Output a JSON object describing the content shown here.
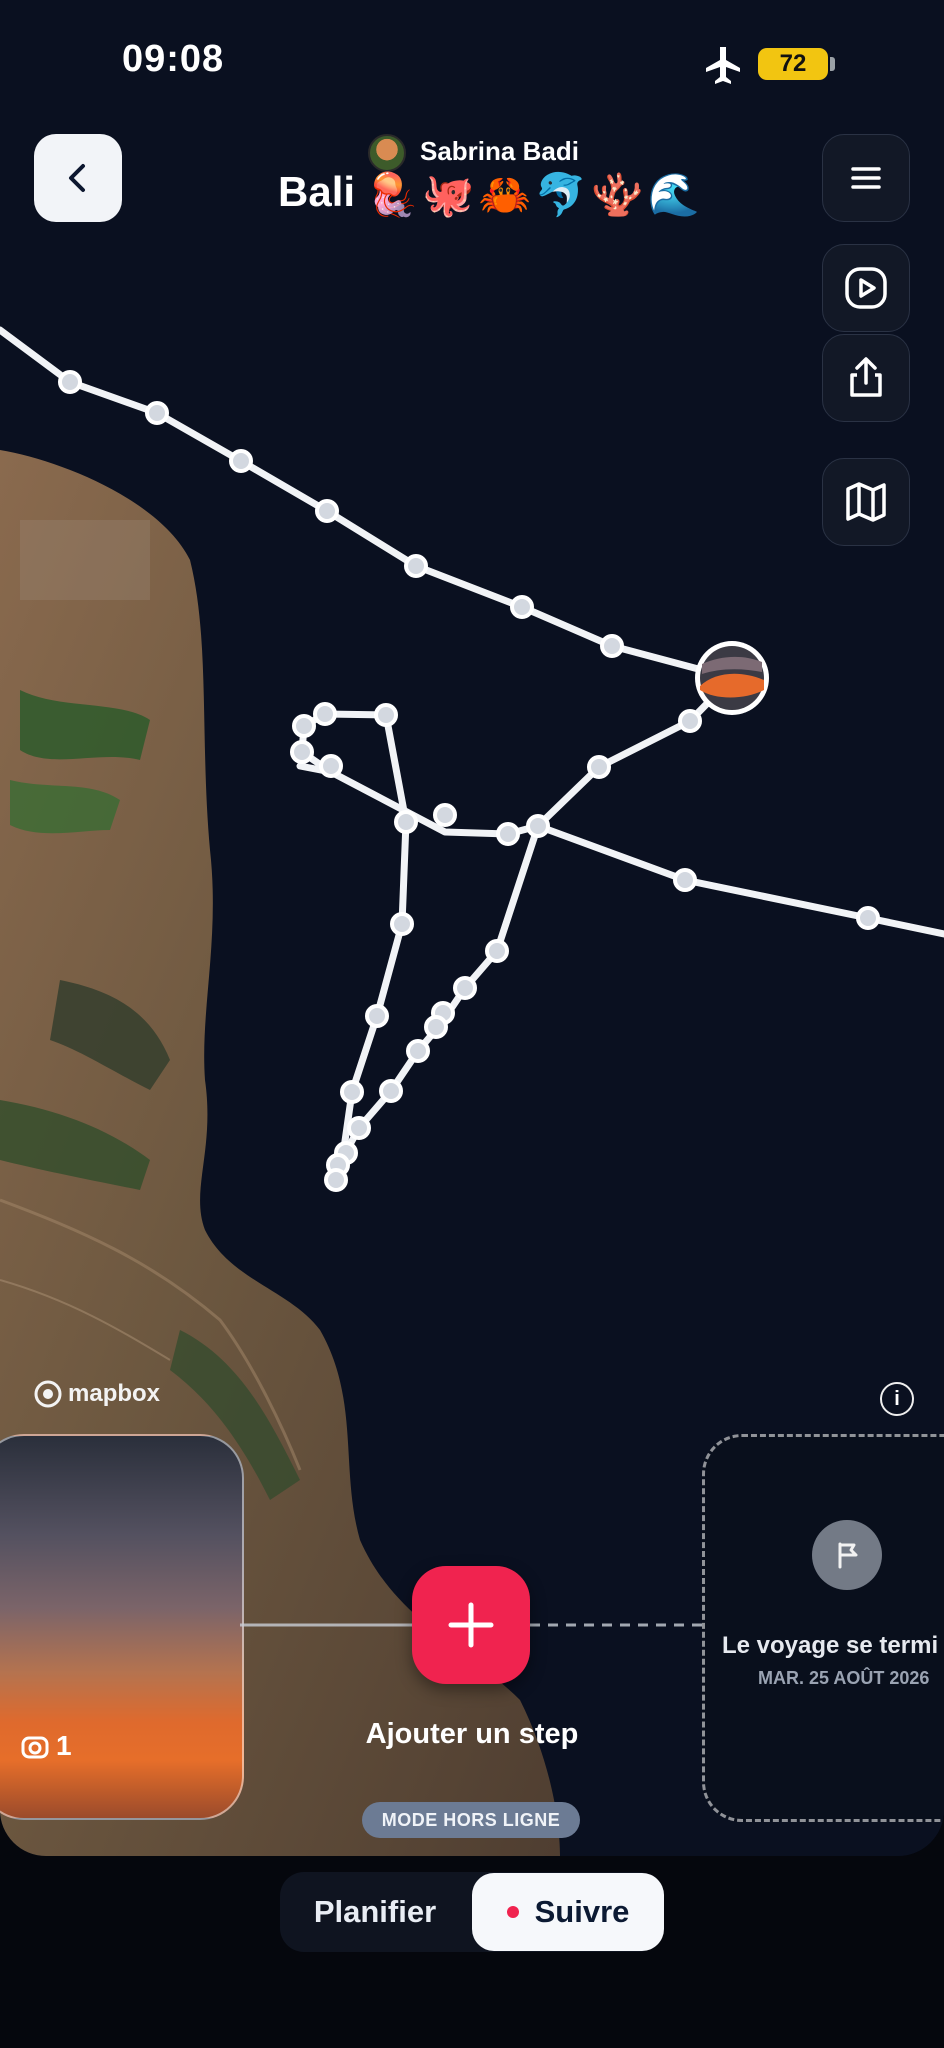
{
  "status_bar": {
    "time": "09:08",
    "battery": "72"
  },
  "header": {
    "trip_title": "Bali",
    "user_name": "Sabrina Badi",
    "emojis": "🪼🐙🦀🐬🪸🌊"
  },
  "map": {
    "attribution": "mapbox"
  },
  "timeline": {
    "photo_count": "1",
    "add_step_label": "Ajouter un step",
    "offline_badge": "MODE HORS LIGNE",
    "end_title": "Le voyage se termi",
    "end_date": "MAR. 25 AOÛT 2026"
  },
  "tabs": {
    "plan": "Planifier",
    "follow": "Suivre"
  },
  "colors": {
    "accent": "#f0234f",
    "battery": "#f2c511",
    "offline": "#6c7b94"
  },
  "icons": [
    "chevron-left-icon",
    "menu-icon",
    "play-icon",
    "share-icon",
    "map-icon",
    "airplane-icon",
    "info-icon",
    "flag-icon",
    "plus-icon",
    "camera-icon"
  ]
}
